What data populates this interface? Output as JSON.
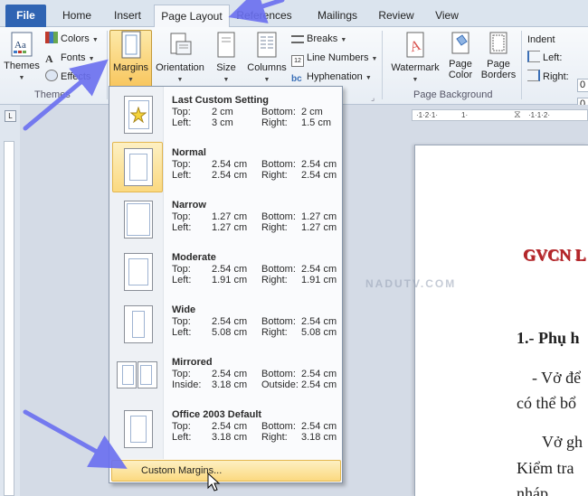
{
  "tabs": [
    {
      "label": "File",
      "name": "tab-file"
    },
    {
      "label": "Home",
      "name": "tab-home"
    },
    {
      "label": "Insert",
      "name": "tab-insert"
    },
    {
      "label": "Page Layout",
      "name": "tab-page-layout"
    },
    {
      "label": "References",
      "name": "tab-references"
    },
    {
      "label": "Mailings",
      "name": "tab-mailings"
    },
    {
      "label": "Review",
      "name": "tab-review"
    },
    {
      "label": "View",
      "name": "tab-view"
    }
  ],
  "ribbon": {
    "themes_label": "Themes",
    "colors_label": "Colors",
    "fonts_label": "Fonts",
    "effects_label": "Effects",
    "themes_group": "Themes",
    "margins_label": "Margins",
    "orientation_label": "Orientation",
    "size_label": "Size",
    "columns_label": "Columns",
    "breaks_label": "Breaks",
    "line_numbers_label": "Line Numbers",
    "hyphenation_label": "Hyphenation",
    "watermark_label": "Watermark",
    "page_color_label": "Page Color",
    "page_borders_label": "Page Borders",
    "page_background_group": "Page Background",
    "indent_label": "Indent",
    "left_label": "Left:",
    "right_label": "Right:",
    "left_value": "0",
    "right_value": "0"
  },
  "margins_menu": {
    "items": [
      {
        "title": "Last Custom Setting",
        "l1a": "Top:",
        "v1a": "2 cm",
        "l1b": "Bottom:",
        "v1b": "2 cm",
        "l2a": "Left:",
        "v2a": "3 cm",
        "l2b": "Right:",
        "v2b": "1.5 cm",
        "icon": "star-icon"
      },
      {
        "title": "Normal",
        "l1a": "Top:",
        "v1a": "2.54 cm",
        "l1b": "Bottom:",
        "v1b": "2.54 cm",
        "l2a": "Left:",
        "v2a": "2.54 cm",
        "l2b": "Right:",
        "v2b": "2.54 cm",
        "icon": "page-icon"
      },
      {
        "title": "Narrow",
        "l1a": "Top:",
        "v1a": "1.27 cm",
        "l1b": "Bottom:",
        "v1b": "1.27 cm",
        "l2a": "Left:",
        "v2a": "1.27 cm",
        "l2b": "Right:",
        "v2b": "1.27 cm",
        "icon": "page-icon"
      },
      {
        "title": "Moderate",
        "l1a": "Top:",
        "v1a": "2.54 cm",
        "l1b": "Bottom:",
        "v1b": "2.54 cm",
        "l2a": "Left:",
        "v2a": "1.91 cm",
        "l2b": "Right:",
        "v2b": "1.91 cm",
        "icon": "page-icon"
      },
      {
        "title": "Wide",
        "l1a": "Top:",
        "v1a": "2.54 cm",
        "l1b": "Bottom:",
        "v1b": "2.54 cm",
        "l2a": "Left:",
        "v2a": "5.08 cm",
        "l2b": "Right:",
        "v2b": "5.08 cm",
        "icon": "page-icon"
      },
      {
        "title": "Mirrored",
        "l1a": "Top:",
        "v1a": "2.54 cm",
        "l1b": "Bottom:",
        "v1b": "2.54 cm",
        "l2a": "Inside:",
        "v2a": "3.18 cm",
        "l2b": "Outside:",
        "v2b": "2.54 cm",
        "icon": "mirrored-pages-icon"
      },
      {
        "title": "Office 2003 Default",
        "l1a": "Top:",
        "v1a": "2.54 cm",
        "l1b": "Bottom:",
        "v1b": "2.54 cm",
        "l2a": "Left:",
        "v2a": "3.18 cm",
        "l2b": "Right:",
        "v2b": "3.18 cm",
        "icon": "page-icon"
      }
    ],
    "custom_label": "Custom Margins..."
  },
  "document": {
    "gvcn": "GVCN L",
    "heading": "1.- Phụ h",
    "line1": "- Vở để",
    "line2": "có thể bổ",
    "line3": "Vở gh",
    "line4": "Kiểm tra",
    "line5": "nháp"
  },
  "watermark_text": "NADUTV.COM",
  "accent_colors": {
    "file_tab": "#2f64b3",
    "highlight": "#fbd980",
    "arrow": "#6a6ff0",
    "gvcn_red": "#b3262a"
  }
}
